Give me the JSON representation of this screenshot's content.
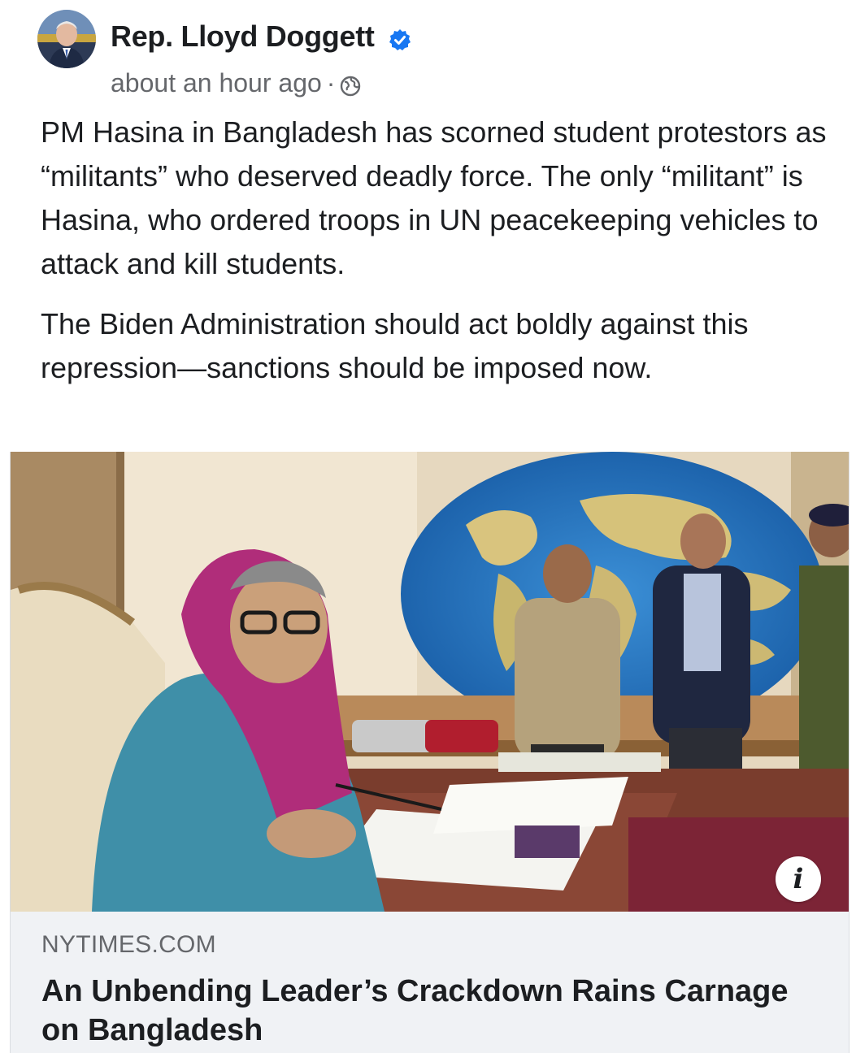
{
  "post": {
    "author": "Rep. Lloyd Doggett",
    "timestamp": "about an hour ago",
    "separator": "·",
    "audience_icon": "globe-icon",
    "verified_icon": "verified-badge-icon",
    "paragraphs": [
      "PM Hasina in Bangladesh has scorned student protestors as “militants” who deserved deadly force. The only “militant” is Hasina, who ordered troops in UN peacekeeping vehicles to attack and kill students.",
      "The Biden Administration should act boldly against this repression—sanctions should be imposed now."
    ]
  },
  "link_card": {
    "source": "NYTIMES.COM",
    "headline": "An Unbending Leader’s Crackdown Rains Carnage on Bangladesh",
    "info_label": "i"
  },
  "colors": {
    "text": "#1c1e21",
    "muted": "#65676b",
    "verified_blue": "#1877f2",
    "card_bg": "#f0f2f5"
  }
}
